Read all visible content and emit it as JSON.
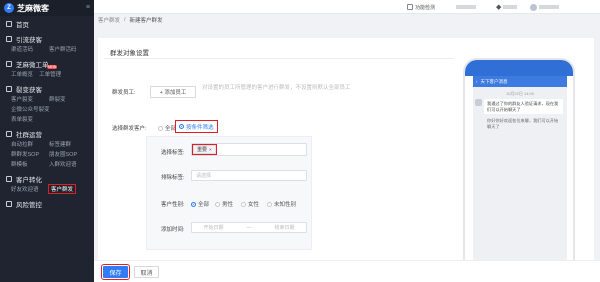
{
  "sidebar": {
    "logo_mark": "Z",
    "app_name": "芝麻微客",
    "groups": [
      {
        "title": "首页",
        "rows": []
      },
      {
        "title": "引流获客",
        "rows": [
          [
            "渠道活码",
            "客户群活码"
          ]
        ]
      },
      {
        "title": "芝麻微工单",
        "rows": [
          [
            "工单概览",
            "工单管理"
          ]
        ],
        "badge": "NEW"
      },
      {
        "title": "裂变获客",
        "rows": [
          [
            "客户裂变",
            "群裂变"
          ],
          [
            "企微公众号裂变",
            ""
          ],
          [
            "表单裂变"
          ]
        ]
      },
      {
        "title": "社群运营",
        "rows": [
          [
            "自动拉群",
            "标签建群"
          ],
          [
            "群群发SOP",
            "朋友圈SOP"
          ],
          [
            "群模板",
            "入群欢迎语"
          ]
        ]
      },
      {
        "title": "客户转化",
        "rows": [
          [
            "好友欢迎语",
            "客户群发"
          ]
        ]
      },
      {
        "title": "风险管控",
        "rows": []
      }
    ]
  },
  "topbar": {
    "function_test": "功能检测",
    "item2": "",
    "item3": ""
  },
  "breadcrumb": {
    "parent": "客户群发",
    "sep": "/",
    "current": "新建客户群发"
  },
  "form": {
    "section_title": "群发对象设置",
    "staff_label": "群发员工:",
    "add_staff_button": "+ 添加员工",
    "staff_hint": "对设置的员工所管理的客户进行群发，不设置则默认全部员工",
    "customer_label": "选择群发客户:",
    "radio_all": "全部",
    "radio_filter": "按条件筛选",
    "filter": {
      "tag_label": "选择标签:",
      "tag_value": "重要",
      "tag_remove": "×",
      "exclude_label": "排除标签:",
      "exclude_placeholder": "请选择",
      "gender_label": "客户性别:",
      "gender_options": [
        "全部",
        "男性",
        "女性",
        "未知性别"
      ],
      "time_label": "添加时间:",
      "time_start": "开始日期",
      "time_sep": "—",
      "time_end": "结束日期"
    }
  },
  "footer": {
    "save": "保存",
    "cancel": "取消"
  },
  "preview": {
    "chat_title": "天下客户消息",
    "time": "10月22日 14:00",
    "msg1": "我通过了你的群友人验证请求，现在我们可以开始聊天了",
    "msg2": "你好你好欢迎各位来聊，我们可以开始聊天了"
  },
  "colors": {
    "primary": "#2f7cf6",
    "highlight": "#e02020",
    "sidebar_bg": "#1f2430"
  }
}
